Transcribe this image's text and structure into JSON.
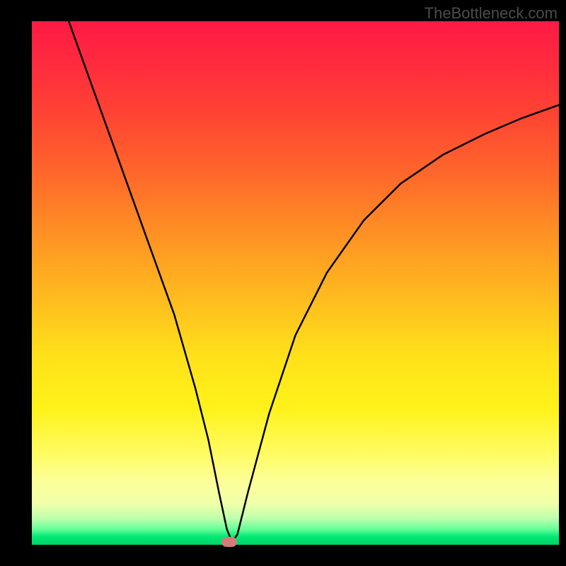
{
  "watermark": "TheBottleneck.com",
  "chart_data": {
    "type": "line",
    "title": "",
    "xlabel": "",
    "ylabel": "",
    "x_range": [
      0,
      1
    ],
    "y_range": [
      0,
      1
    ],
    "series": [
      {
        "name": "curve",
        "points": [
          {
            "x": 0.07,
            "y": 1.0
          },
          {
            "x": 0.12,
            "y": 0.86
          },
          {
            "x": 0.17,
            "y": 0.72
          },
          {
            "x": 0.22,
            "y": 0.58
          },
          {
            "x": 0.27,
            "y": 0.44
          },
          {
            "x": 0.31,
            "y": 0.3
          },
          {
            "x": 0.335,
            "y": 0.2
          },
          {
            "x": 0.355,
            "y": 0.1
          },
          {
            "x": 0.37,
            "y": 0.03
          },
          {
            "x": 0.38,
            "y": 0.005
          },
          {
            "x": 0.39,
            "y": 0.02
          },
          {
            "x": 0.41,
            "y": 0.1
          },
          {
            "x": 0.45,
            "y": 0.25
          },
          {
            "x": 0.5,
            "y": 0.4
          },
          {
            "x": 0.56,
            "y": 0.52
          },
          {
            "x": 0.63,
            "y": 0.62
          },
          {
            "x": 0.7,
            "y": 0.69
          },
          {
            "x": 0.78,
            "y": 0.745
          },
          {
            "x": 0.86,
            "y": 0.785
          },
          {
            "x": 0.93,
            "y": 0.815
          },
          {
            "x": 1.0,
            "y": 0.84
          }
        ]
      }
    ],
    "marker": {
      "x": 0.375,
      "y": 0.0
    },
    "gradient_stops": [
      {
        "pos": 0.0,
        "color": "#ff1a44"
      },
      {
        "pos": 0.5,
        "color": "#ffc81f"
      },
      {
        "pos": 0.85,
        "color": "#fffc66"
      },
      {
        "pos": 1.0,
        "color": "#00d566"
      }
    ]
  }
}
